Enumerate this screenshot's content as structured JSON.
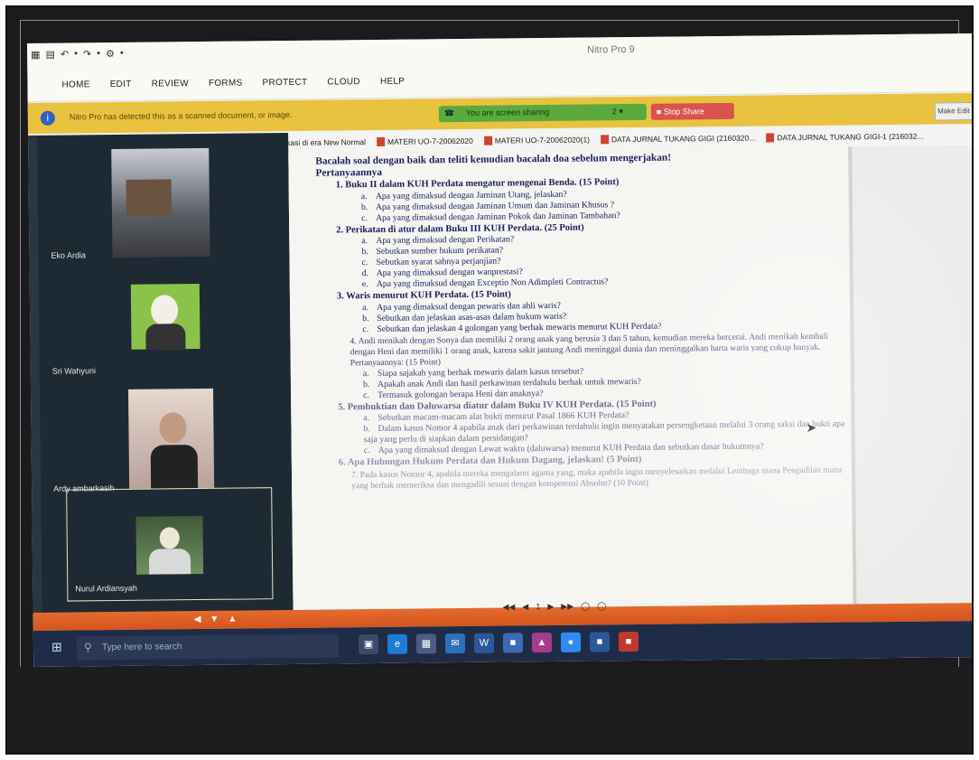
{
  "app": {
    "title": "Nitro Pro 9",
    "quick_access": [
      "▦",
      "▤",
      "↶",
      "•",
      "↷",
      "•",
      "⚙",
      "•"
    ]
  },
  "ribbon": {
    "tabs": [
      "HOME",
      "EDIT",
      "REVIEW",
      "FORMS",
      "PROTECT",
      "CLOUD",
      "HELP"
    ]
  },
  "notice": {
    "text": "Nitro Pro has detected this as a scanned document, or image.",
    "make_editable": "Make Edit"
  },
  "zoom_share": {
    "status": "You are screen sharing",
    "count": "2  ▾",
    "stop_label": "■ Stop Share"
  },
  "bookmarks": [
    "publikasi di era New Normal",
    "MATERI UO-7-20062020",
    "MATERI UO-7-20062020(1)",
    "DATA JURNAL TUKANG GIGI (2160320...",
    "DATA JURNAL TUKANG GIGI-1 (216032..."
  ],
  "participants": [
    {
      "name": "Eko Ardia"
    },
    {
      "name": "Sri Wahyuni"
    },
    {
      "name": "Ardy ambarkasih"
    },
    {
      "name": "Nurul Ardiansyah"
    }
  ],
  "document": {
    "intro": "Bacalah soal dengan baik dan teliti kemudian bacalah doa sebelum mengerjakan!",
    "heading": "Pertanyaannya",
    "questions": [
      {
        "text": "1.  Buku II dalam KUH Perdata mengatur mengenai Benda. (15 Point)",
        "subs": [
          {
            "letter": "a.",
            "text": "Apa yang dimaksud dengan Jaminan Utang, jelaskan?"
          },
          {
            "letter": "b.",
            "text": "Apa yang dimaksud dengan Jaminan Umum dan Jaminan Khusus ?"
          },
          {
            "letter": "c.",
            "text": "Apa yang dimaksud dengan Jaminan Pokok dan Jaminan Tambahan?"
          }
        ]
      },
      {
        "text": "2.  Perikatan di atur dalam Buku III KUH Perdata. (25 Point)",
        "subs": [
          {
            "letter": "a.",
            "text": "Apa yang dimaksud dengan Perikatan?"
          },
          {
            "letter": "b.",
            "text": "Sebutkan sumber hukum perikatan?"
          },
          {
            "letter": "c.",
            "text": "Sebutkan syarat sahnya perjanjian?"
          },
          {
            "letter": "d.",
            "text": "Apa yang dimaksud dengan wanprestasi?"
          },
          {
            "letter": "e.",
            "text": "Apa yang dimaksud dengan Exceptio Non Adimpleti Contractus?"
          }
        ]
      },
      {
        "text": "3.  Waris menurut KUH Perdata. (15 Point)",
        "subs": [
          {
            "letter": "a.",
            "text": "Apa yang dimaksud dengan pewaris dan ahli waris?"
          },
          {
            "letter": "b.",
            "text": "Sebutkan dan jelaskan asas-asas dalam hukum waris?"
          },
          {
            "letter": "c.",
            "text": "Sebutkan dan jelaskan 4 golongan yang berhak mewaris menurut KUH Perdata?"
          }
        ]
      },
      {
        "text": "4.  Andi menikah dengan Sonya dan memiliki 2 orang anak yang berusia 3 dan 5 tahun, kemudian mereka bercerai. Andi menikah kembali dengan Heni dan memiliki 1 orang anak, karena sakit jantung Andi meninggal dunia dan meninggalkan harta waris yang cukup banyak. Pertanyaannya: (15 Point)",
        "subs": [
          {
            "letter": "a.",
            "text": "Siapa sajakah yang berhak mewaris dalam kasus tersebut?"
          },
          {
            "letter": "b.",
            "text": "Apakah anak Andi dan hasil perkawinan terdahulu berhak untuk mewaris?"
          },
          {
            "letter": "c.",
            "text": "Termasuk golongan berapa Heni dan anaknya?"
          }
        ]
      },
      {
        "text": "5.  Pembuktian dan Daluwarsa diatur dalam Buku IV KUH Perdata. (15 Point)",
        "subs": [
          {
            "letter": "a.",
            "text": "Sebutkan macam-macam alat bukti menurut Pasal 1866 KUH Perdata?"
          },
          {
            "letter": "b.",
            "text": "Dalam kasus Nomor 4 apabila anak dari perkawinan terdahulu ingin menyatakan persengketaan melalui 3 orang saksi dan bukti apa saja yang perlu di siapkan dalam persidangan?"
          },
          {
            "letter": "c.",
            "text": "Apa yang dimaksud dengan Lewat waktu (daluwarsa) menurut KUH Perdata dan sebutkan dasar hukumnya?"
          }
        ]
      },
      {
        "text": "6.  Apa Hubungan Hukum Perdata dan Hukum Dagang, jelaskan! (5 Point)",
        "subs": []
      },
      {
        "text": "7.  Pada kasus Nomor 4, apabila mereka mengalami agama yang, maka apabila ingin menyelesaikan melalui Lembaga mana Pengadilan mana yang berhak memeriksa dan mengadili sesuai dengan kompetensi Absolut? (10 Point)",
        "subs": []
      }
    ]
  },
  "footer": {
    "controls": [
      "◀",
      "▼",
      "▲"
    ],
    "page_nav": [
      "◀◀",
      "◀",
      "1",
      "▶",
      "▶▶",
      "◯",
      "◯"
    ]
  },
  "taskbar": {
    "start": "⊞",
    "search_placeholder": "Type here to search",
    "icons": [
      "▣",
      "e",
      "▦",
      "✉",
      "W",
      "■",
      "▲",
      "●",
      "■",
      "■"
    ]
  },
  "colors": {
    "warning_bar": "#e9c23f",
    "share_pill": "#5aaa3c",
    "stop_share": "#d9534f",
    "doc_footer": "#e56b2e",
    "taskbar": "#1f2c47",
    "zoom_panel": "#1e2a33"
  }
}
